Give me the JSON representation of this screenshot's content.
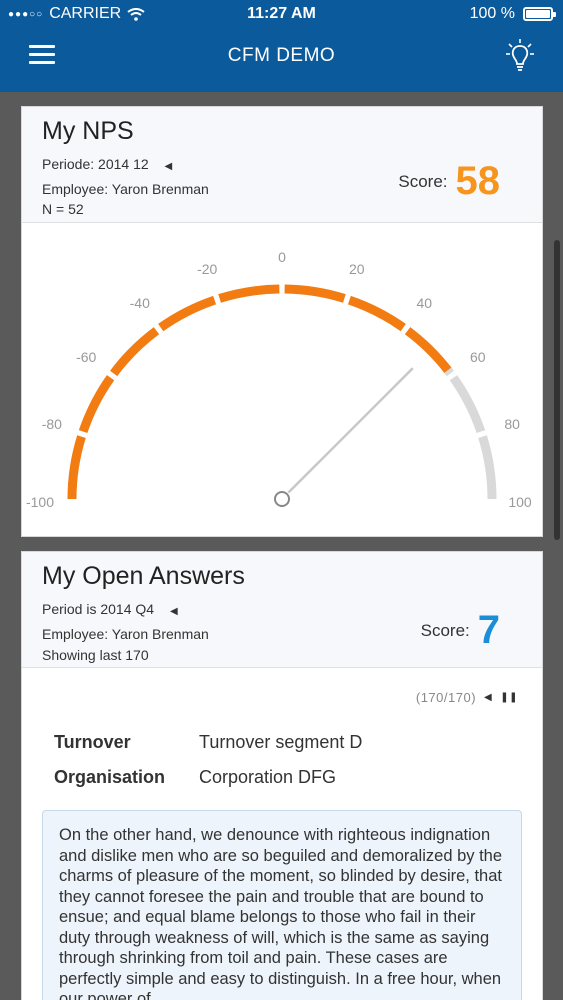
{
  "status_bar": {
    "carrier": "CARRIER",
    "time": "11:27 AM",
    "battery": "100 %"
  },
  "nav": {
    "title": "CFM DEMO",
    "menu_icon": "hamburger-menu-icon",
    "tips_icon": "lightbulb-icon"
  },
  "nps_card": {
    "title": "My NPS",
    "period": "Periode: 2014 12",
    "employee": "Employee: Yaron Brenman",
    "n": "N = 52",
    "score_label": "Score:",
    "score": "58",
    "score_color": "#f7941d",
    "gauge": {
      "value": 58,
      "min": -100,
      "max": 100,
      "ticks": [
        "-100",
        "-80",
        "-60",
        "-40",
        "-20",
        "0",
        "20",
        "40",
        "60",
        "80",
        "100"
      ],
      "active_color": "#f27c12",
      "inactive_color": "#d9d9d9"
    }
  },
  "answers_card": {
    "title": "My Open Answers",
    "period": "Period is 2014 Q4",
    "employee": "Employee: Yaron Brenman",
    "showing": "Showing last 170",
    "score_label": "Score:",
    "score": "7",
    "score_color": "#1a8fd8",
    "pager": "(170/170)",
    "fields": [
      {
        "key": "Turnover",
        "value": "Turnover segment D"
      },
      {
        "key": "Organisation",
        "value": "Corporation DFG"
      }
    ],
    "answer_text": "On the other hand, we denounce with righteous indignation and dislike men who are so beguiled and demoralized by the charms of pleasure of the moment, so blinded by desire, that they cannot foresee the pain and trouble that are bound to ensue; and equal blame belongs to those who fail in their duty through weakness of will, which is the same as saying through shrinking from toil and pain. These cases are perfectly simple and easy to distinguish. In a free hour, when our power of"
  }
}
